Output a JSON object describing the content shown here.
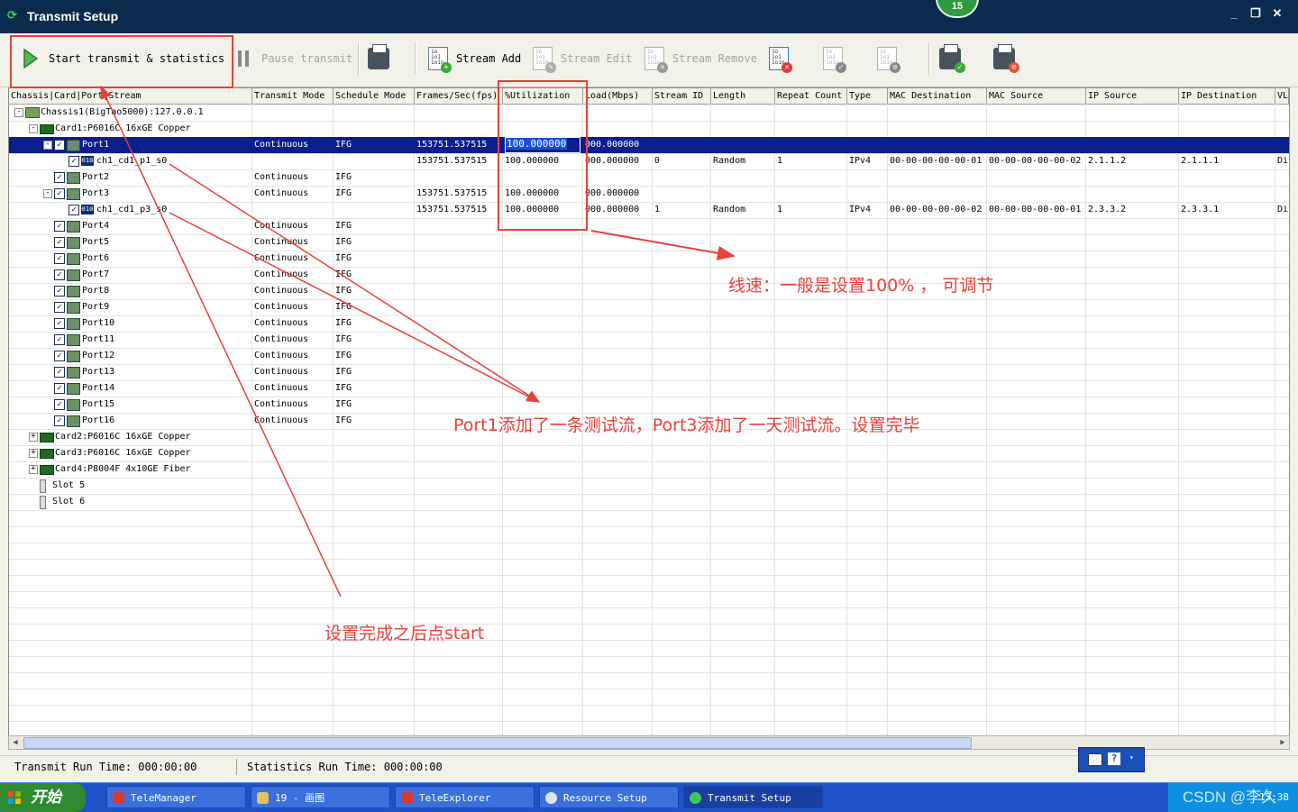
{
  "window": {
    "title": "Transmit Setup",
    "badge": "15",
    "min_btn": "_",
    "max_btn": "❐",
    "close_btn": "✕"
  },
  "toolbar": {
    "start_label": "Start transmit & statistics",
    "pause_label": "Pause transmit",
    "stream_add_label": "Stream Add",
    "stream_edit_label": "Stream Edit",
    "stream_remove_label": "Stream Remove"
  },
  "columns": [
    "Chassis|Card|Port|Stream",
    "Transmit Mode",
    "Schedule Mode",
    "Frames/Sec(fps)",
    "%Utilization",
    "Load(Mbps)",
    "Stream ID",
    "Length",
    "Repeat Count",
    "Type",
    "MAC Destination",
    "MAC Source",
    "IP Source",
    "IP Destination",
    "VL"
  ],
  "tree": [
    {
      "label": "Chassis1(BigTao5000):127.0.0.1"
    },
    {
      "label": "Card1:P6016C 16xGE Copper"
    },
    {
      "label": "Port1",
      "tx": "Continuous",
      "sched": "IFG",
      "fps": "153751.537515",
      "util": "100.000000",
      "load": "000.000000"
    },
    {
      "label": "ch1_cd1_p1_s0",
      "fps": "153751.537515",
      "util": "100.000000",
      "load": "000.000000",
      "sid": "0",
      "len": "Random",
      "rep": "1",
      "type": "IPv4",
      "macd": "00-00-00-00-00-01",
      "macs": "00-00-00-00-00-02",
      "ips": "2.1.1.2",
      "ipd": "2.1.1.1",
      "vl": "Di"
    },
    {
      "label": "Port2",
      "tx": "Continuous",
      "sched": "IFG"
    },
    {
      "label": "Port3",
      "tx": "Continuous",
      "sched": "IFG",
      "fps": "153751.537515",
      "util": "100.000000",
      "load": "000.000000"
    },
    {
      "label": "ch1_cd1_p3_s0",
      "fps": "153751.537515",
      "util": "100.000000",
      "load": "000.000000",
      "sid": "1",
      "len": "Random",
      "rep": "1",
      "type": "IPv4",
      "macd": "00-00-00-00-00-02",
      "macs": "00-00-00-00-00-01",
      "ips": "2.3.3.2",
      "ipd": "2.3.3.1",
      "vl": "Di"
    },
    {
      "label": "Port4",
      "tx": "Continuous",
      "sched": "IFG"
    },
    {
      "label": "Port5",
      "tx": "Continuous",
      "sched": "IFG"
    },
    {
      "label": "Port6",
      "tx": "Continuous",
      "sched": "IFG"
    },
    {
      "label": "Port7",
      "tx": "Continuous",
      "sched": "IFG"
    },
    {
      "label": "Port8",
      "tx": "Continuous",
      "sched": "IFG"
    },
    {
      "label": "Port9",
      "tx": "Continuous",
      "sched": "IFG"
    },
    {
      "label": "Port10",
      "tx": "Continuous",
      "sched": "IFG"
    },
    {
      "label": "Port11",
      "tx": "Continuous",
      "sched": "IFG"
    },
    {
      "label": "Port12",
      "tx": "Continuous",
      "sched": "IFG"
    },
    {
      "label": "Port13",
      "tx": "Continuous",
      "sched": "IFG"
    },
    {
      "label": "Port14",
      "tx": "Continuous",
      "sched": "IFG"
    },
    {
      "label": "Port15",
      "tx": "Continuous",
      "sched": "IFG"
    },
    {
      "label": "Port16",
      "tx": "Continuous",
      "sched": "IFG"
    },
    {
      "label": "Card2:P6016C 16xGE Copper"
    },
    {
      "label": "Card3:P6016C 16xGE Copper"
    },
    {
      "label": "Card4:P8004F 4x10GE Fiber"
    },
    {
      "label": "Slot 5"
    },
    {
      "label": "Slot 6"
    }
  ],
  "status": {
    "transmit": "Transmit Run Time: 000:00:00",
    "statistics": "Statistics Run Time: 000:00:00"
  },
  "taskbar": {
    "start": "开始",
    "items": [
      "TeleManager",
      "19 - 画图",
      "TeleExplorer",
      "Resource Setup",
      "Transmit Setup"
    ],
    "watermark": "CSDN @李久",
    "clock": "15:38"
  },
  "annotations": {
    "line_speed": "线速：一般是设置100% ， 可调节",
    "streams": "Port1添加了一条测试流，Port3添加了一天测试流。设置完毕",
    "start": "设置完成之后点start"
  },
  "colors": {
    "accent_red": "#e8403a",
    "selection_blue": "#0a1e8c",
    "title_bar": "#0a2a4e",
    "taskbar_blue": "#1f52c8"
  }
}
